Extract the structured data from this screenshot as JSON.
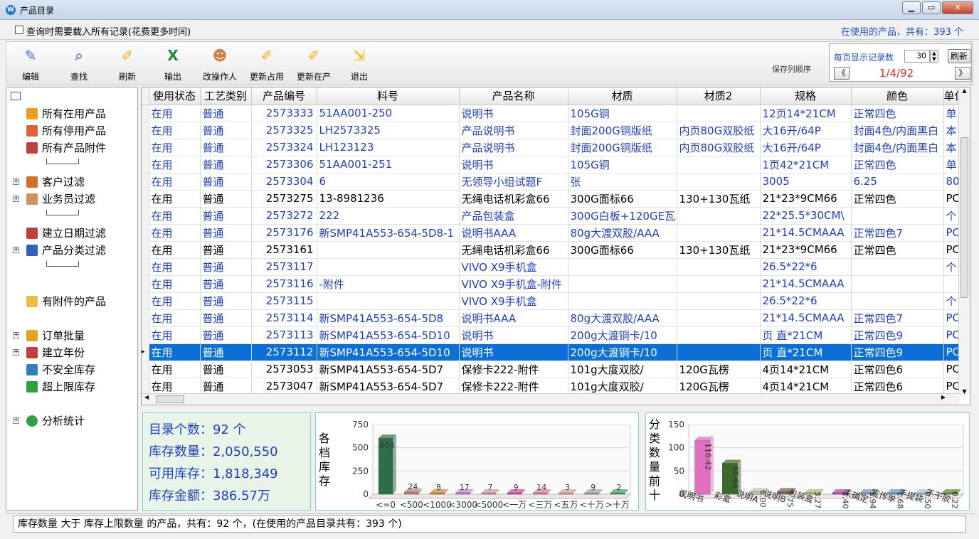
{
  "window": {
    "title": "产品目录",
    "app_icon": "W"
  },
  "options": {
    "load_all_label": "查询时需要载入所有记录(花费更多时间)",
    "in_use_summary": "在使用的产品，共有：393 个"
  },
  "toolbar": {
    "buttons": [
      {
        "label": "编辑",
        "icon": "edit-pen-icon",
        "color": "#3a6fd8"
      },
      {
        "label": "查找",
        "icon": "search-magnifier-icon",
        "color": "#6b8bc8"
      },
      {
        "label": "刷新",
        "icon": "refresh-brush-icon",
        "color": "#f0b020"
      },
      {
        "label": "输出",
        "icon": "excel-icon",
        "color": "#1e8a3a"
      },
      {
        "label": "改操作人",
        "icon": "users-icon",
        "color": "#d08040"
      },
      {
        "label": "更新占用",
        "icon": "update-brush-icon",
        "color": "#f0b020"
      },
      {
        "label": "更新在产",
        "icon": "update-brush-icon",
        "color": "#f0b020"
      },
      {
        "label": "退出",
        "icon": "exit-icon",
        "color": "#f0c020"
      }
    ],
    "save_column_order": "保存列顺序",
    "per_page_label": "每页显示记录数",
    "per_page_value": "30",
    "refresh": "刷新",
    "page_indicator": "1/4/92",
    "prev": "《",
    "next": "》"
  },
  "tree": {
    "items": [
      {
        "label": "所有在用产品",
        "icon": "folder-product-icon",
        "color": "#e8a020"
      },
      {
        "label": "所有停用产品",
        "icon": "folder-stop-icon",
        "color": "#e06040"
      },
      {
        "label": "所有产品附件",
        "icon": "attachment-list-icon",
        "color": "#c04040"
      },
      {
        "label": "客户过滤",
        "icon": "house-icon",
        "color": "#d07020"
      },
      {
        "label": "业务员过滤",
        "icon": "person-icon",
        "color": "#d09060"
      },
      {
        "label": "建立日期过滤",
        "icon": "calendar-icon",
        "color": "#c04040"
      },
      {
        "label": "产品分类过滤",
        "icon": "bar-chart-icon",
        "color": "#3060c0"
      },
      {
        "label": "有附件的产品",
        "icon": "document-attachment-icon",
        "color": "#e8c040"
      },
      {
        "label": "订单批量",
        "icon": "folder-batch-icon",
        "color": "#e8a020"
      },
      {
        "label": "建立年份",
        "icon": "calendar-icon",
        "color": "#c04040"
      },
      {
        "label": "不安全库存",
        "icon": "stock-warning-icon",
        "color": "#3080c0"
      },
      {
        "label": "超上限库存",
        "icon": "stock-over-icon",
        "color": "#30a040"
      },
      {
        "label": "分析统计",
        "icon": "pie-chart-icon",
        "color": "#30a040"
      }
    ]
  },
  "table": {
    "columns": [
      "使用状态",
      "工艺类别",
      "产品编号",
      "料号",
      "产品名称",
      "材质",
      "材质2",
      "规格",
      "颜色",
      "单位"
    ],
    "rows": [
      {
        "style": "blue",
        "cells": [
          "在用",
          "普通",
          "2573333",
          "51AA001-250",
          "说明书",
          "105G铜",
          "",
          "12页14*21CM",
          "正常四色",
          "单"
        ]
      },
      {
        "style": "blue",
        "cells": [
          "在用",
          "普通",
          "2573325",
          "LH2573325",
          "产品说明书",
          "封面200G铜版纸",
          "内页80G双胶纸",
          "大16开/64P",
          "封面4色/内面黑白",
          "本"
        ]
      },
      {
        "style": "blue",
        "cells": [
          "在用",
          "普通",
          "2573324",
          "LH123123",
          "产品说明书",
          "封面200G铜版纸",
          "内页80G双胶纸",
          "大16开/64P",
          "封面4色/内面黑白",
          "本"
        ]
      },
      {
        "style": "blue",
        "cells": [
          "在用",
          "普通",
          "2573306",
          "51AA001-251",
          "说明书",
          "105G铜",
          "",
          "1页42*21CM",
          "正常四色",
          "单"
        ]
      },
      {
        "style": "blue",
        "cells": [
          "在用",
          "普通",
          "2573304",
          "6",
          "无领导小组试题F",
          "张",
          "",
          "3005",
          "6.25",
          "80"
        ]
      },
      {
        "style": "black",
        "cells": [
          "在用",
          "普通",
          "2573275",
          "13-8981236",
          "无绳电话机彩盒66",
          "300G面标66",
          "130+130瓦纸",
          "21*23*9CM66",
          "正常四色",
          "PC"
        ]
      },
      {
        "style": "blue",
        "cells": [
          "在用",
          "普通",
          "2573272",
          "222",
          "产品包装盒",
          "300G白板+120GE瓦",
          "",
          "22*25.5*30CM\\",
          "",
          "个"
        ]
      },
      {
        "style": "blue",
        "cells": [
          "在用",
          "普通",
          "2573176",
          "新SMP41A553-654-5D8-1",
          "说明书AAA",
          "80g大渡双胶/AAA",
          "",
          "21*14.5CMAAA",
          "正常四色7",
          "PC"
        ]
      },
      {
        "style": "black",
        "cells": [
          "在用",
          "普通",
          "2573161",
          "",
          "无绳电话机彩盒66",
          "300G面标66",
          "130+130瓦纸",
          "21*23*9CM66",
          "正常四色",
          "PC"
        ]
      },
      {
        "style": "blue",
        "cells": [
          "在用",
          "普通",
          "2573117",
          "",
          "VIVO X9手机盒",
          "",
          "",
          "26.5*22*6",
          "",
          "个"
        ]
      },
      {
        "style": "blue",
        "cells": [
          "在用",
          "普通",
          "2573116",
          "-附件",
          "VIVO X9手机盒-附件",
          "",
          "",
          "21*14.5CMAAA",
          "",
          ""
        ]
      },
      {
        "style": "blue",
        "cells": [
          "在用",
          "普通",
          "2573115",
          "",
          "VIVO X9手机盒",
          "",
          "",
          "26.5*22*6",
          "",
          "个"
        ]
      },
      {
        "style": "blue",
        "cells": [
          "在用",
          "普通",
          "2573114",
          "新SMP41A553-654-5D8",
          "说明书AAA",
          "80g大渡双胶/AAA",
          "",
          "21*14.5CMAAA",
          "正常四色7",
          "PC"
        ]
      },
      {
        "style": "blue",
        "cells": [
          "在用",
          "普通",
          "2573113",
          "新SMP41A553-654-5D10",
          "说明书",
          "200g大渡铜卡/10",
          "",
          "页 直*21CM",
          "正常四色9",
          "PC"
        ]
      },
      {
        "style": "sel",
        "cells": [
          "在用",
          "普通",
          "2573112",
          "新SMP41A553-654-5D10",
          "说明书",
          "200g大渡铜卡/10",
          "",
          "页 直*21CM",
          "正常四色9",
          "PC"
        ]
      },
      {
        "style": "black",
        "cells": [
          "在用",
          "普通",
          "2573053",
          "新SMP41A553-654-5D7",
          "保修卡222-附件",
          "101g大度双胶/",
          "120G瓦楞",
          "4页14*21CM",
          "正常四色6",
          "PC"
        ]
      },
      {
        "style": "black",
        "cells": [
          "在用",
          "普通",
          "2573047",
          "新SMP41A553-654-5D7",
          "保修卡222-附件",
          "101g大度双胶/",
          "120G瓦楞",
          "4页14*21CM",
          "正常四色6",
          "PC"
        ]
      }
    ]
  },
  "stats": {
    "lines": [
      "目录个数：92 个",
      "库存数量：2,050,550",
      "可用库存：1,818,349",
      "库存金额：386.57万"
    ]
  },
  "chart_data": [
    {
      "type": "bar",
      "title_vertical": "各档库存",
      "ylim": [
        0,
        750
      ],
      "yticks": [
        "750",
        "500",
        "250",
        "0"
      ],
      "categories": [
        "<=0",
        "<500",
        "<1000",
        "<3000",
        "<5000",
        "<一万",
        "<三万",
        "<五万",
        "<十万",
        ">十万"
      ],
      "values": [
        604,
        24,
        8,
        17,
        7,
        9,
        14,
        3,
        9,
        2
      ],
      "value_labels": [
        "604",
        "24",
        "8",
        "17",
        "7",
        "9",
        "14",
        "3",
        "9",
        "2"
      ],
      "colors": [
        "#2e6e48",
        "#b08070",
        "#d08030",
        "#c080d0",
        "#d090a0",
        "#d040a0",
        "#e070a0",
        "#d0a0a0",
        "#a0a0a0",
        "#40a060"
      ]
    },
    {
      "type": "bar",
      "title_vertical": "分类数量前十",
      "ylim": [
        0,
        150
      ],
      "yticks": [
        "150",
        "100",
        "50",
        "0"
      ],
      "categories": [
        "说明书",
        "彩盒",
        "说明A",
        "说明B",
        "包装盒",
        "",
        "未确定",
        "宣传单",
        "手提袋",
        "不干胶"
      ],
      "values": [
        116.42,
        66.64,
        6,
        5.75,
        3.27,
        2.4,
        1.94,
        1.68,
        0.5,
        0.22
      ],
      "value_labels": [
        "116.42",
        "66.64",
        "6.00",
        "5.75",
        "3.27",
        "2.40",
        "1.94",
        "1.68",
        "0.50",
        "0.22"
      ],
      "colors": [
        "#e070c0",
        "#3a6a2a",
        "#c0c0b0",
        "#806050",
        "#a0c060",
        "#b040a0",
        "#7090b0",
        "#6090c0",
        "#a0c0e0",
        "#608030"
      ]
    }
  ],
  "status": {
    "text": "库存数量 大于 库存上限数量 的产品，共有：92 个，(在使用的产品目录共有：393 个)"
  }
}
